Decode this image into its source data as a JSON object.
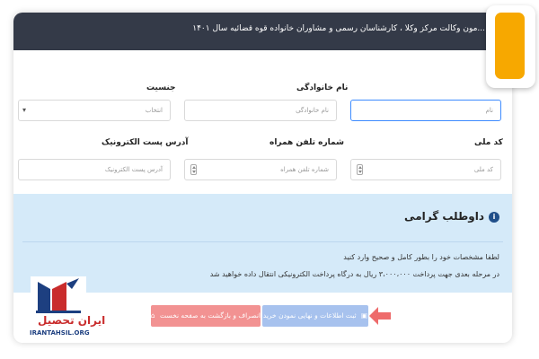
{
  "header": {
    "title": "...مون وکالت مرکز وکلا ، کارشناسان رسمی و مشاوران خانواده قوه قضائیه سال ۱۴۰۱"
  },
  "form": {
    "row1": {
      "gender": {
        "label": "جنسیت",
        "value": "انتخاب"
      },
      "last_name": {
        "label": "نام خانوادگی",
        "placeholder": "نام خانوادگی"
      },
      "first_name": {
        "placeholder": "نام"
      }
    },
    "row2": {
      "email": {
        "label": "آدرس پست الکترونیک",
        "placeholder": "آدرس پست الکترونیک"
      },
      "mobile": {
        "label": "شماره تلفن همراه",
        "placeholder": "شماره تلفن همراه"
      },
      "national_code": {
        "label": "کد ملی",
        "placeholder": "کد ملی"
      }
    }
  },
  "info": {
    "title": "داوطلب گرامی",
    "line1": "لطفا مشخصات خود را بطور کامل و صحیح وارد کنید",
    "line2": "در مرحله بعدی جهت پرداخت ۳،۰۰۰،۰۰۰ ریال به درگاه پرداخت الکترونیکی انتقال داده خواهید شد"
  },
  "buttons": {
    "submit": "ثبت اطلاعات و نهایی نمودن خرید",
    "cancel": "انصراف و بازگشت به صفحه نخست"
  },
  "watermark": {
    "name": "ایران تحصیل",
    "site": "IRANTAHSIL.ORG"
  },
  "colors": {
    "topbar": "#343a48",
    "accent": "#f7a800",
    "info_bg": "#d5eaf9",
    "primary_button": "#a7c2ee",
    "danger_button": "#f29292",
    "arrow": "#ee6b6b",
    "logo_red": "#c92c2c"
  },
  "icons": {
    "info": "info-circle-icon",
    "submit": "save-icon",
    "cancel": "home-icon",
    "dropdown": "chevron-down-icon",
    "spinner": "number-spinner-icon",
    "arrow": "arrow-left-icon"
  }
}
